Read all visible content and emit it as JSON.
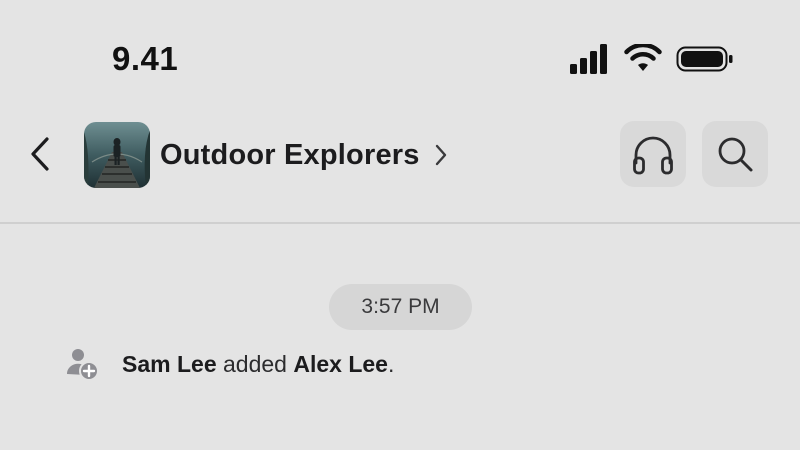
{
  "status_bar": {
    "time": "9.41",
    "icons": [
      "cellular-signal-icon",
      "wifi-icon",
      "battery-icon"
    ]
  },
  "header": {
    "back_icon": "chevron-left-icon",
    "group_title": "Outdoor Explorers",
    "group_avatar": "forest-bridge-photo",
    "title_chevron_icon": "chevron-right-icon",
    "actions": [
      "headphones-icon",
      "search-icon"
    ]
  },
  "chat": {
    "timestamp": "3:57 PM",
    "system_message": {
      "icon": "add-member-icon",
      "actor": "Sam Lee",
      "verb": " added ",
      "target": "Alex Lee",
      "end": "."
    }
  },
  "colors": {
    "background": "#e4e4e4",
    "button_bg": "#d9d9d9",
    "pill_bg": "#d6d6d6",
    "text": "#1c1c1e"
  }
}
